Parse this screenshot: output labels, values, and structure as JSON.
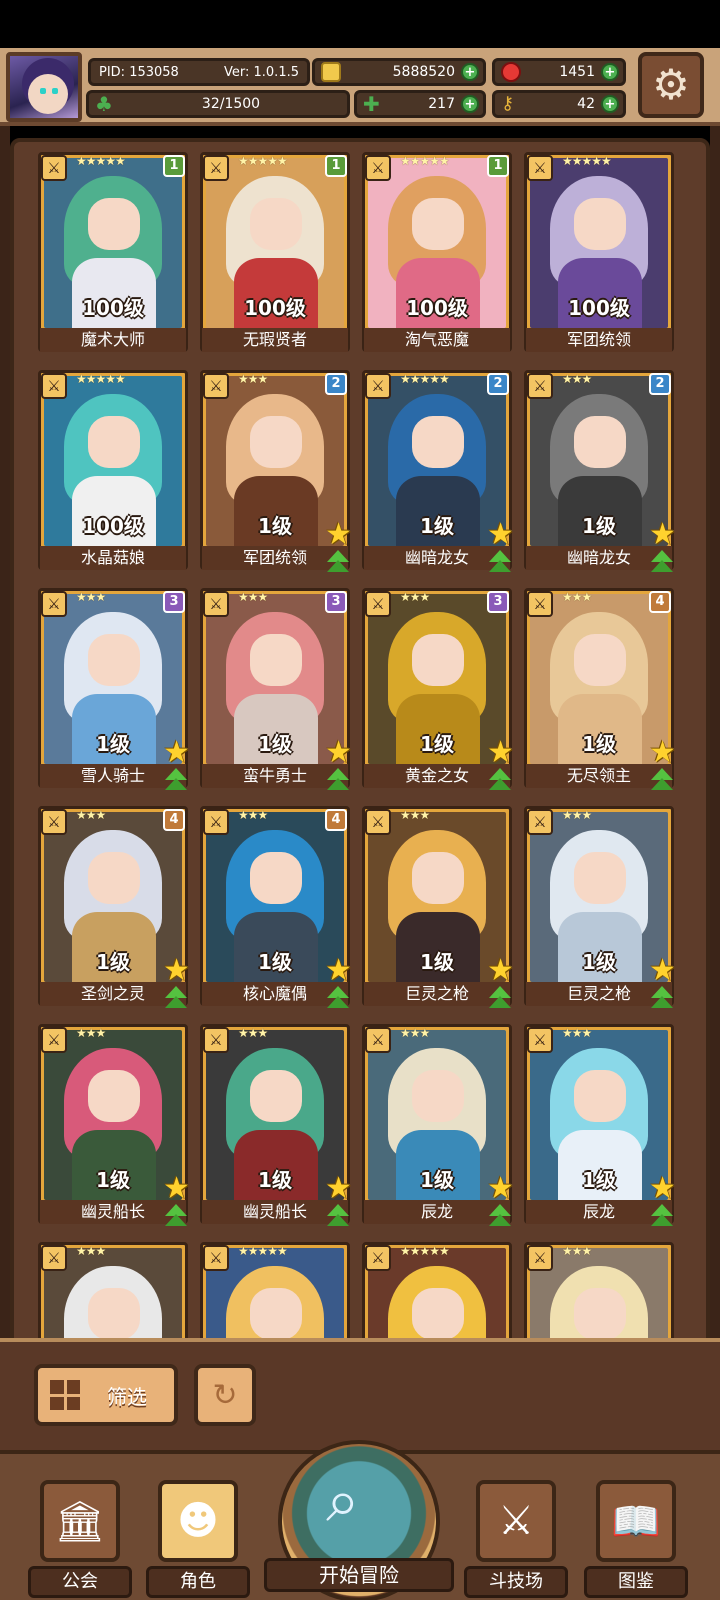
{
  "header": {
    "pid": "PID: 153058",
    "version": "Ver: 1.0.1.5",
    "gold": "5888520",
    "gems": "1451",
    "exp": "32/1500",
    "clovers": "217",
    "keys": "42"
  },
  "heroes": [
    {
      "name": "魔术大师",
      "level": "100级",
      "stars": "★★★★★",
      "rank": "1",
      "rank_color": "#5a9b3a",
      "hair": "#4fb08e",
      "body": "#e8e8f0",
      "bg": "#3f6f8a",
      "promo": false
    },
    {
      "name": "无瑕贤者",
      "level": "100级",
      "stars": "★★★★★",
      "rank": "1",
      "rank_color": "#5a9b3a",
      "hair": "#eee2cf",
      "body": "#c43a3a",
      "bg": "#d7a05a",
      "promo": false
    },
    {
      "name": "淘气恶魔",
      "level": "100级",
      "stars": "★★★★★",
      "rank": "1",
      "rank_color": "#5a9b3a",
      "hair": "#e0a060",
      "body": "#e06a86",
      "bg": "#f1b2c0",
      "promo": false
    },
    {
      "name": "军团统领",
      "level": "100级",
      "stars": "★★★★★",
      "rank": "",
      "rank_color": "",
      "hair": "#bdb0d8",
      "body": "#6a4a9a",
      "bg": "#4b3d6e",
      "promo": false
    },
    {
      "name": "水晶菇娘",
      "level": "100级",
      "stars": "★★★★★",
      "rank": "",
      "rank_color": "",
      "hair": "#4fc4c0",
      "body": "#f0f0f0",
      "bg": "#2f7a9c",
      "promo": false
    },
    {
      "name": "军团统领",
      "level": "1级",
      "stars": "★★★",
      "rank": "2",
      "rank_color": "#3a86c8",
      "hair": "#e8b88a",
      "body": "#6a3a24",
      "bg": "#8a5a3a",
      "promo": true
    },
    {
      "name": "幽暗龙女",
      "level": "1级",
      "stars": "★★★★★",
      "rank": "2",
      "rank_color": "#3a86c8",
      "hair": "#2a6aa8",
      "body": "#2a3a50",
      "bg": "#345066",
      "promo": true
    },
    {
      "name": "幽暗龙女",
      "level": "1级",
      "stars": "★★★",
      "rank": "2",
      "rank_color": "#3a86c8",
      "hair": "#7a7a7a",
      "body": "#3a3a3a",
      "bg": "#4a4a4a",
      "promo": true
    },
    {
      "name": "雪人骑士",
      "level": "1级",
      "stars": "★★★",
      "rank": "3",
      "rank_color": "#8a5ab8",
      "hair": "#dfe7f2",
      "body": "#6aa6d8",
      "bg": "#5a7a9a",
      "promo": true
    },
    {
      "name": "蛮牛勇士",
      "level": "1级",
      "stars": "★★★",
      "rank": "3",
      "rank_color": "#8a5ab8",
      "hair": "#e28a8a",
      "body": "#d8c8c0",
      "bg": "#8a5a4a",
      "promo": true
    },
    {
      "name": "黄金之女",
      "level": "1级",
      "stars": "★★★",
      "rank": "3",
      "rank_color": "#8a5ab8",
      "hair": "#d8a82a",
      "body": "#b88a1a",
      "bg": "#5a4a2a",
      "promo": true
    },
    {
      "name": "无尽领主",
      "level": "1级",
      "stars": "★★★",
      "rank": "4",
      "rank_color": "#c07a3a",
      "hair": "#e8c898",
      "body": "#e0b888",
      "bg": "#c89a6a",
      "promo": true
    },
    {
      "name": "圣剑之灵",
      "level": "1级",
      "stars": "★★★",
      "rank": "4",
      "rank_color": "#c07a3a",
      "hair": "#d8dce8",
      "body": "#c8a060",
      "bg": "#5a4a3a",
      "promo": true
    },
    {
      "name": "核心魔偶",
      "level": "1级",
      "stars": "★★★",
      "rank": "4",
      "rank_color": "#c07a3a",
      "hair": "#2a8ac8",
      "body": "#3a4a5a",
      "bg": "#2a4a5a",
      "promo": true
    },
    {
      "name": "巨灵之枪",
      "level": "1级",
      "stars": "★★★",
      "rank": "",
      "rank_color": "",
      "hair": "#e8b050",
      "body": "#3a2a2a",
      "bg": "#6a4a2a",
      "promo": true
    },
    {
      "name": "巨灵之枪",
      "level": "1级",
      "stars": "★★★",
      "rank": "",
      "rank_color": "",
      "hair": "#e0e8f0",
      "body": "#b8c8d8",
      "bg": "#5a6a7a",
      "promo": true
    },
    {
      "name": "幽灵船长",
      "level": "1级",
      "stars": "★★★",
      "rank": "",
      "rank_color": "",
      "hair": "#d85a7a",
      "body": "#3a5a3a",
      "bg": "#3a4a3a",
      "promo": true
    },
    {
      "name": "幽灵船长",
      "level": "1级",
      "stars": "★★★",
      "rank": "",
      "rank_color": "",
      "hair": "#4aa88a",
      "body": "#8a2a2a",
      "bg": "#3a3a3a",
      "promo": true
    },
    {
      "name": "辰龙",
      "level": "1级",
      "stars": "★★★",
      "rank": "",
      "rank_color": "",
      "hair": "#e8e0c8",
      "body": "#3a8ab8",
      "bg": "#4a6a7a",
      "promo": true
    },
    {
      "name": "辰龙",
      "level": "1级",
      "stars": "★★★",
      "rank": "",
      "rank_color": "",
      "hair": "#8ad8e8",
      "body": "#e8f0f8",
      "bg": "#3a6a8a",
      "promo": true
    },
    {
      "name": "",
      "level": "",
      "stars": "★★★",
      "rank": "",
      "rank_color": "",
      "hair": "#e8e8e8",
      "body": "#8a4a2a",
      "bg": "#5a4a3a",
      "promo": false
    },
    {
      "name": "",
      "level": "",
      "stars": "★★★★★",
      "rank": "",
      "rank_color": "",
      "hair": "#f0c060",
      "body": "#c02a2a",
      "bg": "#3a5a8a",
      "promo": false
    },
    {
      "name": "",
      "level": "",
      "stars": "★★★★★",
      "rank": "",
      "rank_color": "",
      "hair": "#f0c040",
      "body": "#e8a040",
      "bg": "#6a3a2a",
      "promo": false
    },
    {
      "name": "",
      "level": "",
      "stars": "★★★",
      "rank": "",
      "rank_color": "",
      "hair": "#f0e0b0",
      "body": "#e8d8c8",
      "bg": "#8a7a6a",
      "promo": false
    }
  ],
  "filter": {
    "label": "筛选"
  },
  "nav": {
    "guild": "公会",
    "heroes": "角色",
    "start": "开始冒险",
    "arena": "斗技场",
    "codex": "图鉴"
  }
}
